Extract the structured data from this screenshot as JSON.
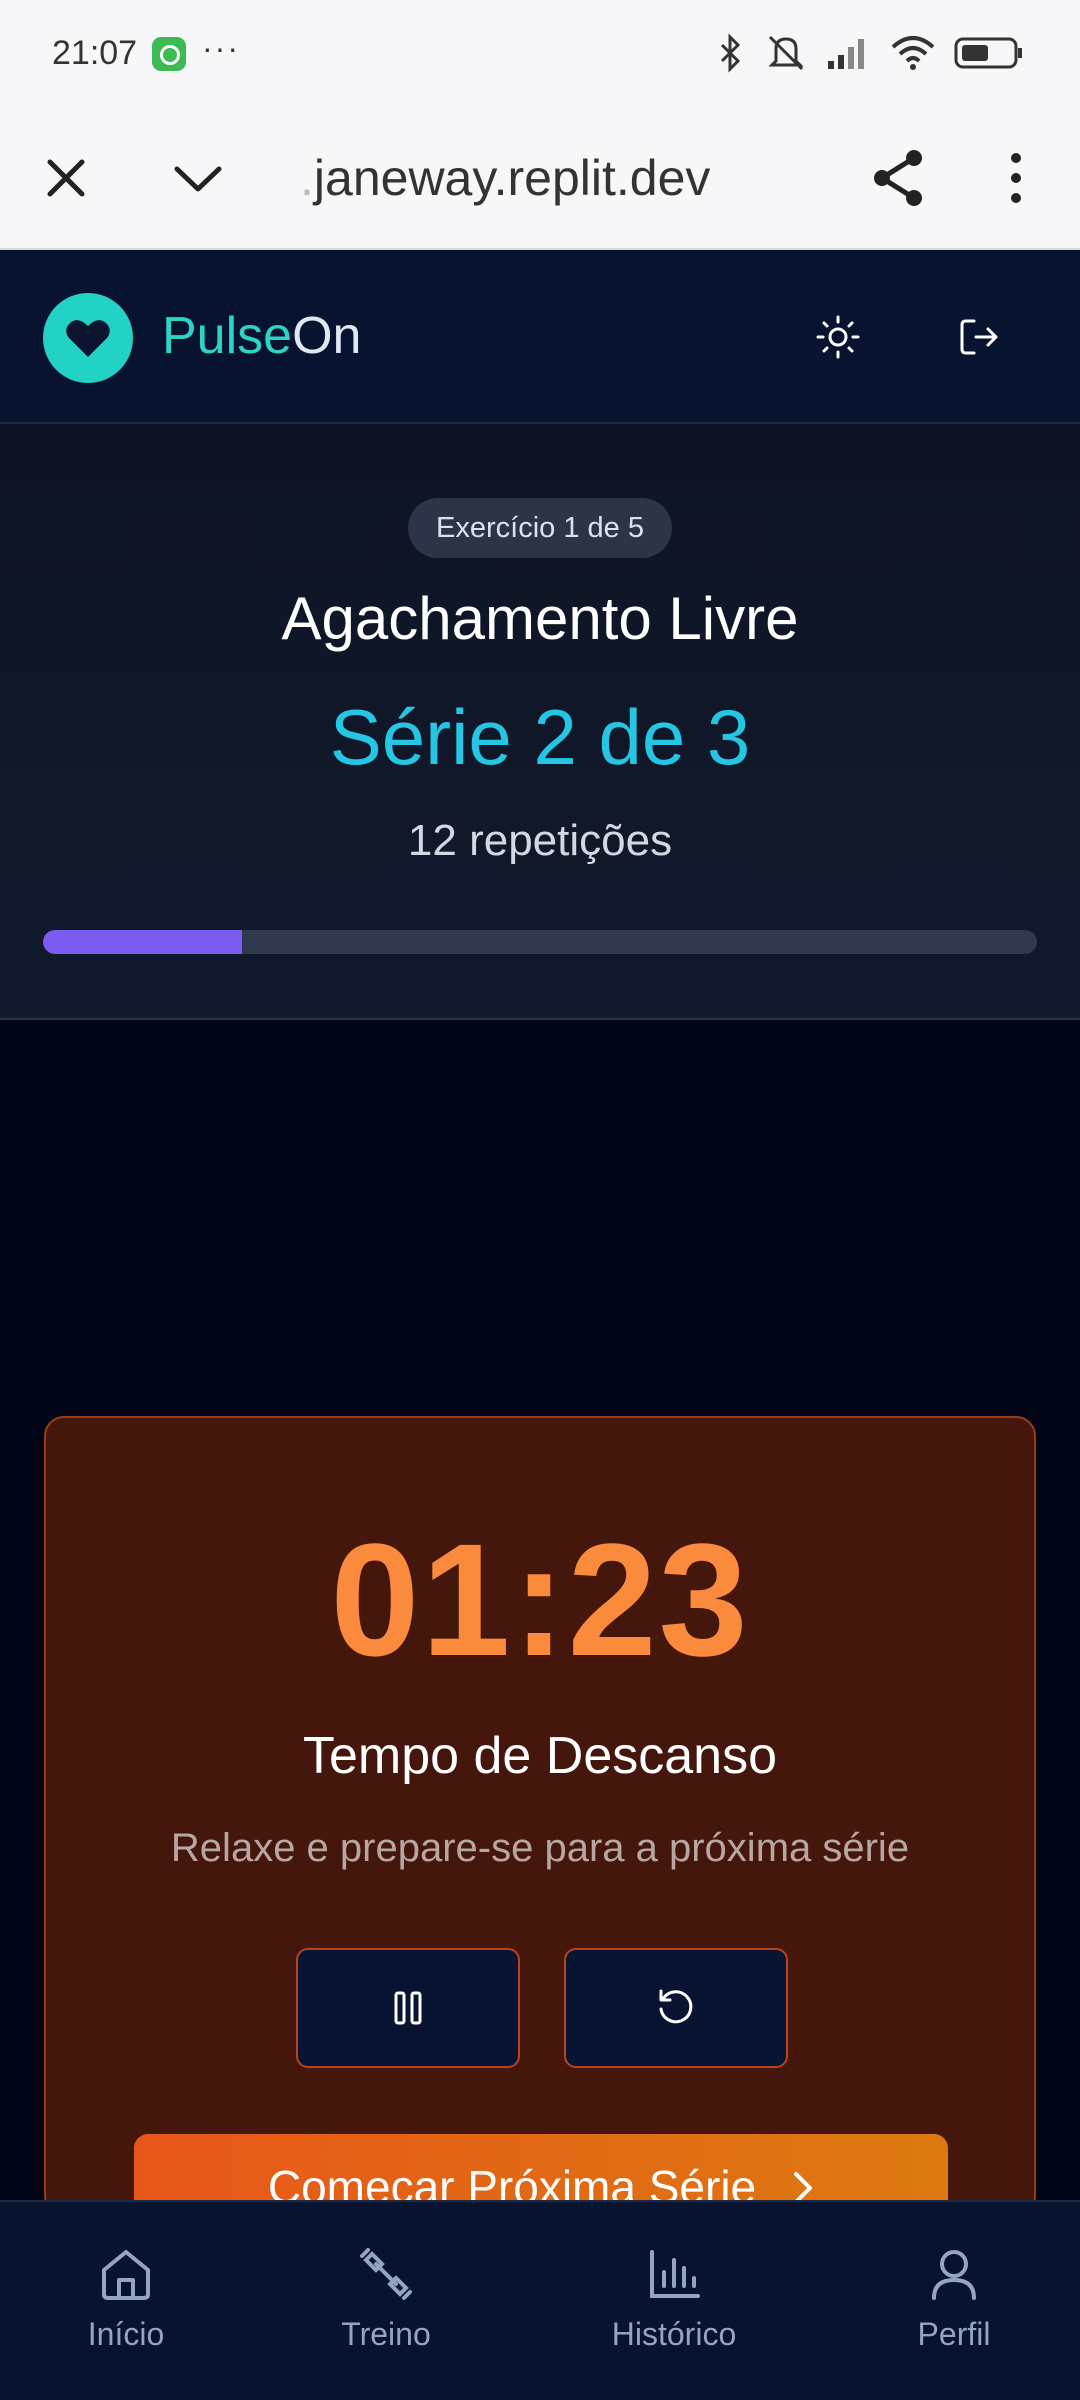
{
  "status_bar": {
    "time": "21:07",
    "more": "···"
  },
  "browser": {
    "url": "janeway.replit.dev"
  },
  "app": {
    "brand_part1": "Pulse",
    "brand_part2": "On"
  },
  "exercise": {
    "badge": "Exercício 1 de 5",
    "name": "Agachamento Livre",
    "set": "Série 2 de 3",
    "reps": "12 repetições",
    "progress_percent": 20
  },
  "rest": {
    "timer": "01:23",
    "title": "Tempo de Descanso",
    "subtitle": "Relaxe e prepare-se para a próxima série",
    "next_button": "Começar Próxima Série"
  },
  "nav": {
    "items": [
      {
        "label": "Início",
        "icon": "home-icon"
      },
      {
        "label": "Treino",
        "icon": "dumbbell-icon"
      },
      {
        "label": "Histórico",
        "icon": "bar-chart-icon"
      },
      {
        "label": "Perfil",
        "icon": "user-icon"
      }
    ]
  },
  "colors": {
    "accent_teal": "#22d3c5",
    "set_cyan": "#25c6e4",
    "progress_purple": "#7c5cf0",
    "timer_orange": "#fb8b3c",
    "button_orange": "#e8571a"
  }
}
